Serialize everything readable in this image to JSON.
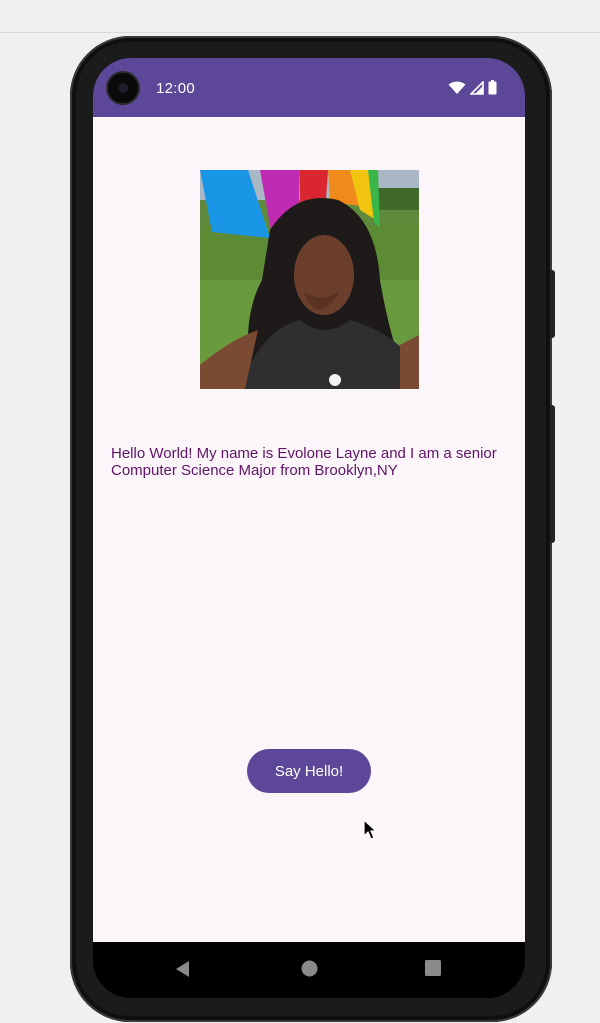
{
  "status_bar": {
    "time": "12:00",
    "color": "#5c4798"
  },
  "main": {
    "greeting_text": "Hello World! My name is Evolone Layne and I am a senior Computer Science Major from Brooklyn,NY",
    "button_label": "Say Hello!",
    "accent_color": "#5c4798",
    "text_color": "#5e1566",
    "background_color": "#fcf6fa"
  },
  "icons": {
    "status": [
      "wifi-icon",
      "cell-signal-icon",
      "battery-icon"
    ],
    "navigation": [
      "back-icon",
      "home-icon",
      "recents-icon"
    ]
  }
}
